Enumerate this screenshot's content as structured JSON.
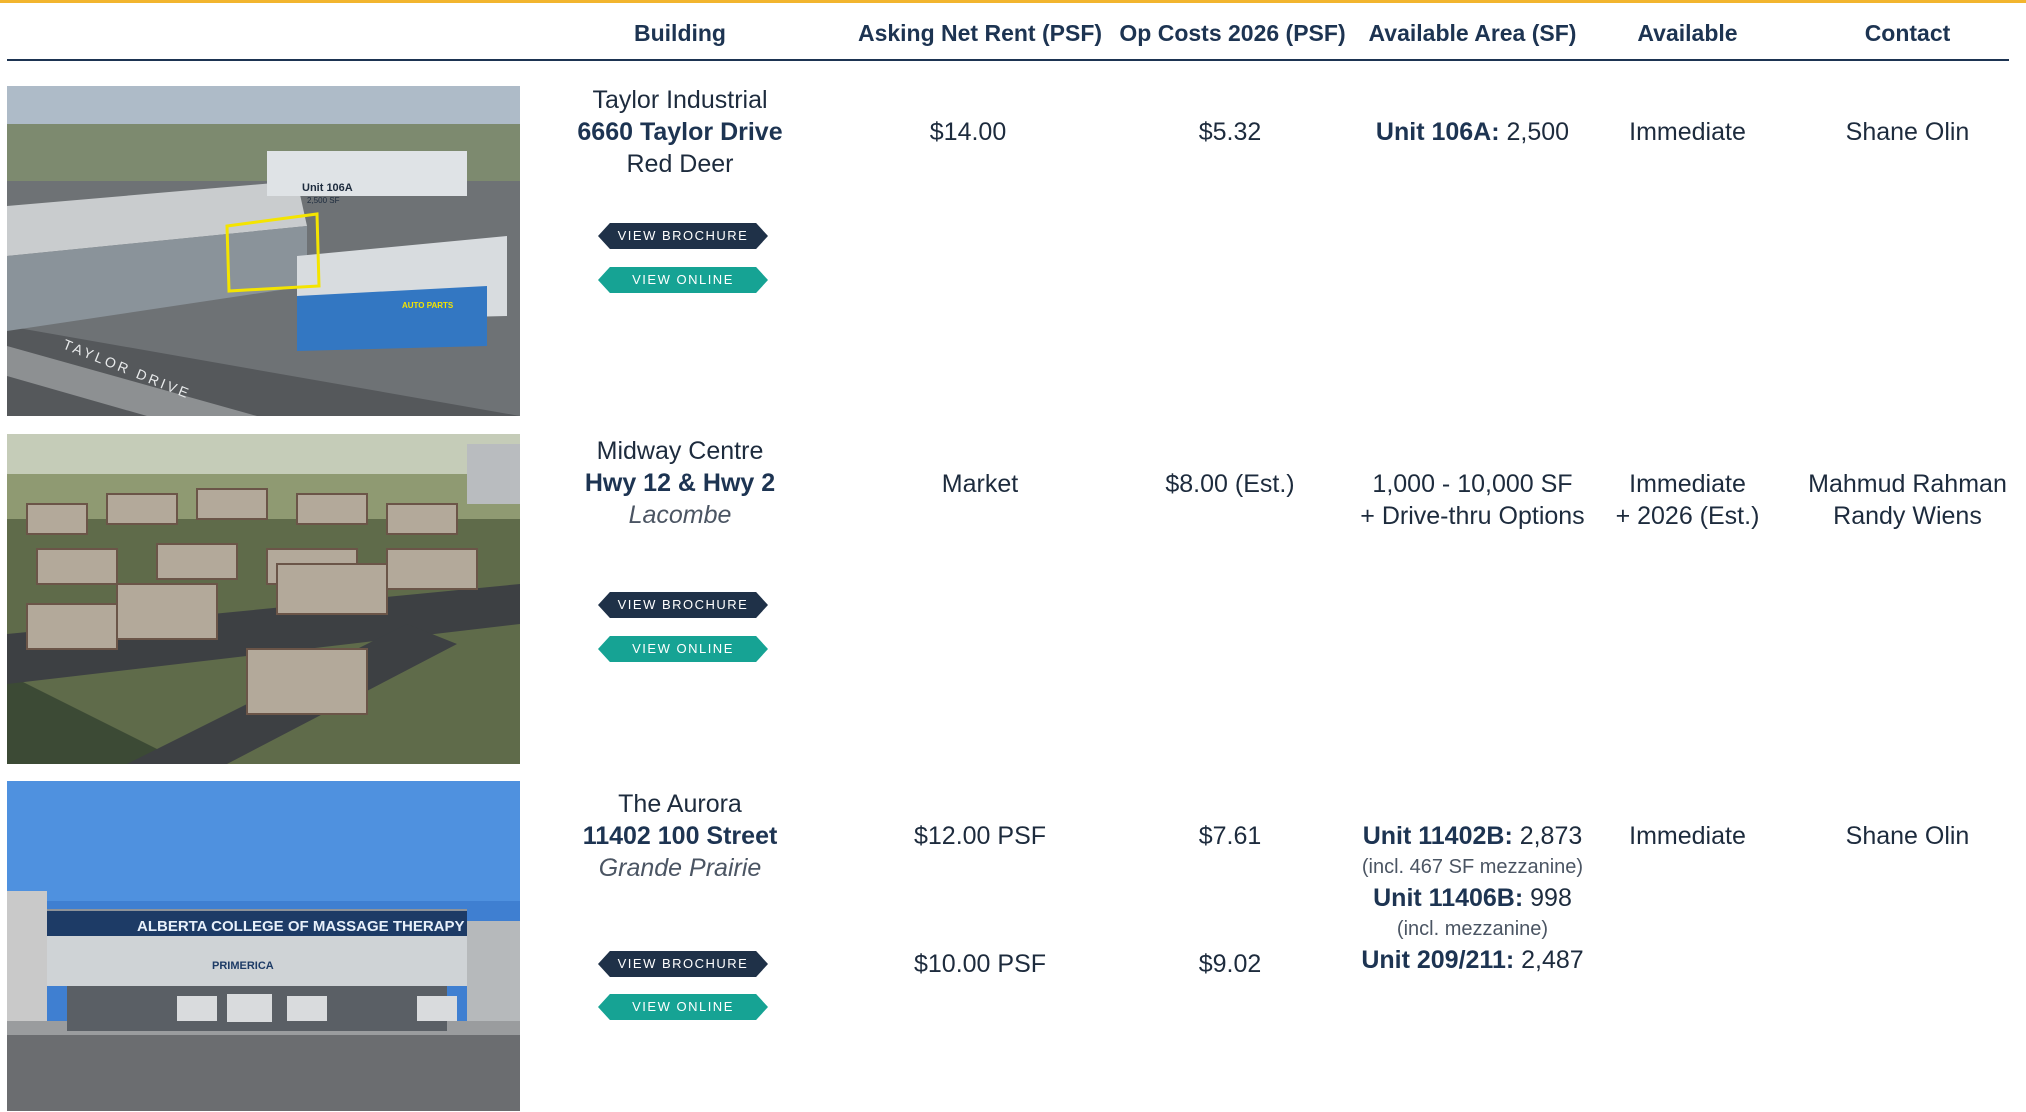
{
  "header": {
    "building": "Building",
    "asking_rent": "Asking Net Rent (PSF)",
    "op_costs": "Op Costs 2026 (PSF)",
    "available_area": "Available Area (SF)",
    "available": "Available",
    "contact": "Contact"
  },
  "buttons": {
    "brochure": "VIEW BROCHURE",
    "online": "VIEW ONLINE"
  },
  "rows": [
    {
      "name": "Taylor Industrial",
      "address": "6660 Taylor Drive",
      "city": "Red Deer",
      "photo_labels": {
        "unit": "Unit 106A",
        "area": "2,500 SF",
        "road": "TAYLOR DRIVE",
        "sign": "AUTO PARTS"
      },
      "rent": "$14.00",
      "op_costs": "$5.32",
      "area_unit": "Unit 106A:",
      "area_value": " 2,500",
      "available": "Immediate",
      "contact": "Shane Olin"
    },
    {
      "name": "Midway Centre",
      "address": "Hwy 12 & Hwy 2",
      "city": "Lacombe",
      "rent": "Market",
      "op_costs": "$8.00 (Est.)",
      "area_line1": "1,000 - 10,000 SF",
      "area_line2": "+ Drive-thru Options",
      "available_line1": "Immediate",
      "available_line2": "+ 2026 (Est.)",
      "contact_line1": "Mahmud Rahman",
      "contact_line2": "Randy Wiens"
    },
    {
      "name": "The Aurora",
      "address": "11402 100 Street",
      "city": "Grande Prairie",
      "photo_labels": {
        "sign1": "ALBERTA COLLEGE OF MASSAGE THERAPY",
        "sign2": "PRIMERICA"
      },
      "rent_1": "$12.00 PSF",
      "rent_2": "$10.00 PSF",
      "op_costs_1": "$7.61",
      "op_costs_2": "$9.02",
      "unit1_label": "Unit 11402B:",
      "unit1_value": " 2,873",
      "unit1_note": "(incl. 467 SF mezzanine)",
      "unit2_label": "Unit 11406B:",
      "unit2_value": " 998",
      "unit2_note": "(incl. mezzanine)",
      "unit3_label": "Unit 209/211:",
      "unit3_value": " 2,487",
      "available": "Immediate",
      "contact": "Shane Olin"
    }
  ]
}
